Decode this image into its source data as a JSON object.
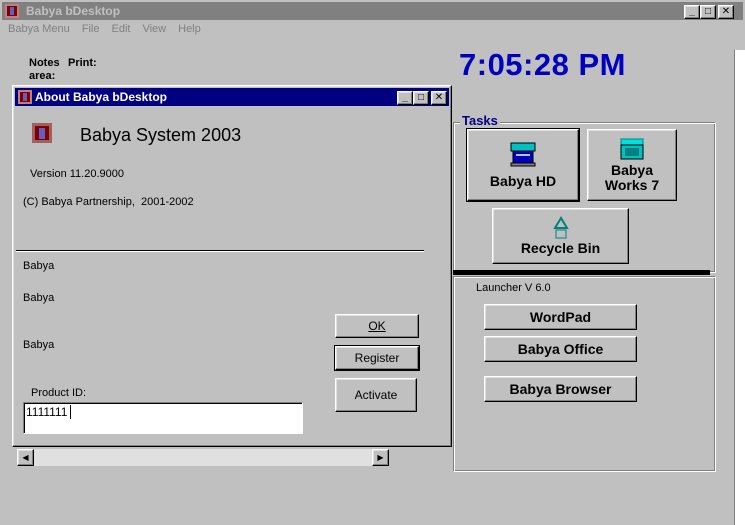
{
  "main_window": {
    "title": "Babya bDesktop",
    "menu": [
      "Babya Menu",
      "File",
      "Edit",
      "View",
      "Help"
    ],
    "notes_label": "Notes\narea:",
    "print_label": "Print:",
    "clock": "7:05:28 PM"
  },
  "tasks": {
    "group_label": "Tasks",
    "buttons": [
      "Babya HD",
      "Babya\nWorks 7",
      "Recycle Bin"
    ]
  },
  "launcher": {
    "version": "Launcher V 6.0",
    "buttons": [
      "WordPad",
      "Babya Office",
      "Babya Browser"
    ]
  },
  "about_dialog": {
    "title": "About Babya bDesktop",
    "product_name": "Babya System 2003",
    "version": "Version 11.20.9000",
    "copyright": "(C) Babya Partnership,  2001-2002",
    "lines": [
      "Babya",
      "Babya",
      "Babya"
    ],
    "ok_label": "OK",
    "register_label": "Register",
    "activate_label": "Activate",
    "product_id_label": "Product ID:",
    "product_id_value": "1111111"
  },
  "colors": {
    "face": "#c0c0c0",
    "active_title": "#000080",
    "inactive_title": "#808080",
    "clock": "#0000c0"
  }
}
